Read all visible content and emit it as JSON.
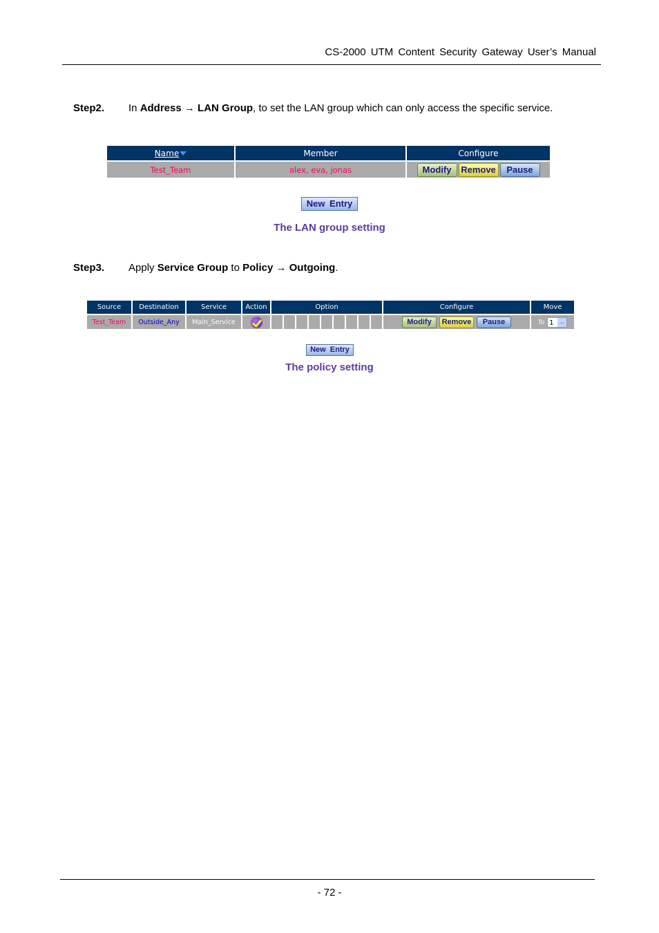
{
  "header": {
    "title": "CS-2000 UTM Content Security Gateway User’s Manual"
  },
  "step2": {
    "label": "Step2.",
    "t1": "In ",
    "b1": "Address → LAN Group",
    "t2": ", to set the LAN group which can only access the specific service."
  },
  "lan_table": {
    "headers": {
      "name": "Name",
      "member": "Member",
      "configure": "Configure"
    },
    "rows": [
      {
        "name": "Test_Team",
        "member": "alex, eva, jonas"
      }
    ],
    "buttons": {
      "modify": "Modify",
      "remove": "Remove",
      "pause": "Pause"
    },
    "new_entry": "New Entry",
    "caption": "The LAN group setting"
  },
  "step3": {
    "label": "Step3.",
    "t1": "Apply ",
    "b1": "Service Group",
    "t2": " to ",
    "b2": "Policy → Outgoing",
    "t3": "."
  },
  "policy_table": {
    "headers": {
      "source": "Source",
      "destination": "Destination",
      "service": "Service",
      "action": "Action",
      "option": "Option",
      "configure": "Configure",
      "move": "Move"
    },
    "rows": [
      {
        "source": "Test_Team",
        "destination": "Outside_Any",
        "service": "Main_Service",
        "action": "permit-check-icon",
        "move_label": "To",
        "move_value": "1"
      }
    ],
    "buttons": {
      "modify": "Modify",
      "remove": "Remove",
      "pause": "Pause"
    },
    "new_entry": "New Entry",
    "caption": "The policy setting"
  },
  "footer": {
    "page_number": "- 72 -"
  }
}
